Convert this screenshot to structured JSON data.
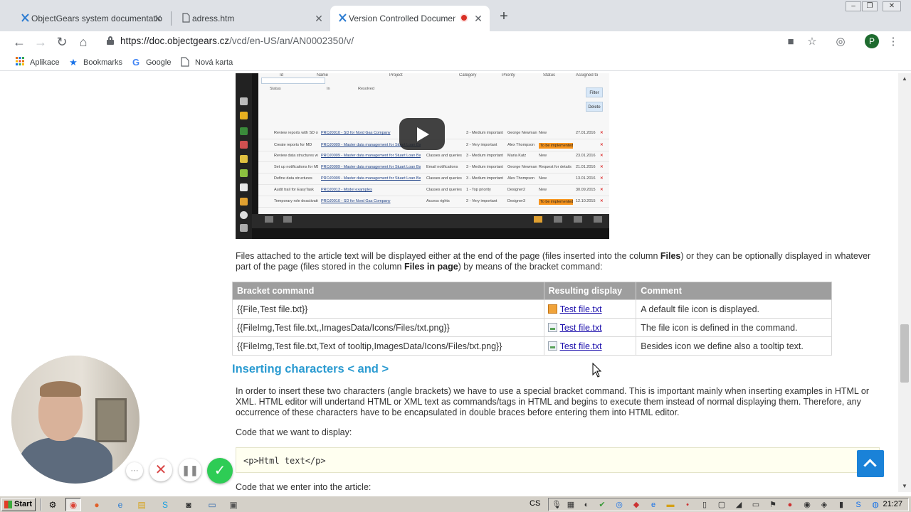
{
  "tabs": [
    {
      "title": "ObjectGears system documentation",
      "icon": "objectgears-icon",
      "active": false
    },
    {
      "title": "adress.htm",
      "icon": "file-icon",
      "active": false
    },
    {
      "title": "Version Controlled Documentat",
      "icon": "objectgears-icon",
      "active": true,
      "recording": true
    }
  ],
  "address": {
    "url_host": "https://doc.objectgears.cz",
    "url_path": "/vcd/en-US/an/AN0002350/v/"
  },
  "profile_initial": "P",
  "bookmarks": [
    {
      "label": "Aplikace",
      "icon": "apps-grid-icon"
    },
    {
      "label": "Bookmarks",
      "icon": "star-icon"
    },
    {
      "label": "Google",
      "icon": "google-icon"
    },
    {
      "label": "Nová karta",
      "icon": "page-icon"
    }
  ],
  "video": {
    "header_columns": [
      "Id",
      "Name",
      "Project",
      "Category",
      "Priority",
      "Status",
      "Assigned to"
    ],
    "filter_labels": {
      "status": "Status",
      "in": "In",
      "resolved": "Resolved"
    },
    "buttons": [
      "Filter",
      "Delete"
    ],
    "rows": [
      {
        "name": "Review reports with SD owner",
        "project": "PROJ0010 - SD for Nord Gas Company",
        "category": "",
        "priority": "3 - Medium important",
        "assigned": "George Newman",
        "status": "New",
        "date": "27.01.2016"
      },
      {
        "name": "Create reports for MD",
        "project": "PROJ0009 - Master data management for Stuart Loan Bank",
        "category": "",
        "priority": "2 - Very important",
        "assigned": "Alex Thompson",
        "status": "To be implemented",
        "date": ""
      },
      {
        "name": "Review data structures with MD owners",
        "project": "PROJ0009 - Master data management for Stuart Loan Bank",
        "category": "Classes and queries",
        "priority": "3 - Medium important",
        "assigned": "Maria Katz",
        "status": "New",
        "date": "23.01.2016"
      },
      {
        "name": "Set up notifications for MD tables",
        "project": "PROJ0009 - Master data management for Stuart Loan Bank",
        "category": "Email notifications",
        "priority": "3 - Medium important",
        "assigned": "George Newman",
        "status": "Request for details",
        "date": "21.01.2016"
      },
      {
        "name": "Define data structures",
        "project": "PROJ0009 - Master data management for Stuart Loan Bank",
        "category": "Classes and queries",
        "priority": "3 - Medium important",
        "assigned": "Alex Thompson",
        "status": "New",
        "date": "13.01.2016"
      },
      {
        "name": "Audit trail for EasyTask",
        "project": "PROJ0013 - Model examples",
        "category": "Classes and queries",
        "priority": "1 - Top priority",
        "assigned": "Designer2",
        "status": "New",
        "date": "30.09.2015"
      },
      {
        "name": "Temporary role deactivation by user",
        "project": "PROJ0010 - SD for Nord Gas Company",
        "category": "Access rights",
        "priority": "2 - Very important",
        "assigned": "Designer3",
        "status": "To be implemented",
        "date": "12.10.2015"
      }
    ]
  },
  "intro": {
    "p1": "Files attached to the article text will be displayed either at the end of the page (files inserted into the column ",
    "b1": "Files",
    "p2": ") or they can be optionally displayed in whatever part of the page (files stored in the column ",
    "b2": "Files in page",
    "p3": ") by means of the bracket command:"
  },
  "files_table": {
    "headers": [
      "Bracket command",
      "Resulting display",
      "Comment"
    ],
    "rows": [
      {
        "command": "{{File,Test file.txt}}",
        "display": "Test file.txt",
        "icon": "default-file-icon",
        "comment": "A default file icon is displayed."
      },
      {
        "command": "{{FileImg,Test file.txt,,ImagesData/Icons/Files/txt.png}}",
        "display": "Test file.txt",
        "icon": "txt-image-icon",
        "comment": "The file icon is defined in the command."
      },
      {
        "command": "{{FileImg,Test file.txt,Text of tooltip,ImagesData/Icons/Files/txt.png}}",
        "display": "Test file.txt",
        "icon": "txt-image-icon",
        "comment": "Besides icon we define also a tooltip text."
      }
    ]
  },
  "section_heading": "Inserting characters <  and  >",
  "section_text": "In order to insert these two characters (angle brackets) we have to use a special bracket command. This is important mainly when inserting examples in HTML or XML. HTML editor will undertand HTML or XML text as commands/tags in HTML and begins to execute them instead of normal displaying them. Therefore, any occurrence of these characters have to be encapsulated in double braces before entering them into HTML editor.",
  "code_label": "Code that we want to display:",
  "code_sample": "<p>Html text</p>",
  "code_label2": "Code that we enter into the article:",
  "taskbar": {
    "start_label": "Start",
    "language": "CS",
    "clock": "21:27"
  },
  "colors": {
    "tab_strip": "#dee1e6",
    "heading_blue": "#2b9bd1",
    "table_header": "#9e9e9e",
    "code_bg": "#fffff0",
    "to_top_button": "#1a82d8",
    "rec_confirm": "#2ecc55",
    "taskbar": "#d4d0c8"
  }
}
